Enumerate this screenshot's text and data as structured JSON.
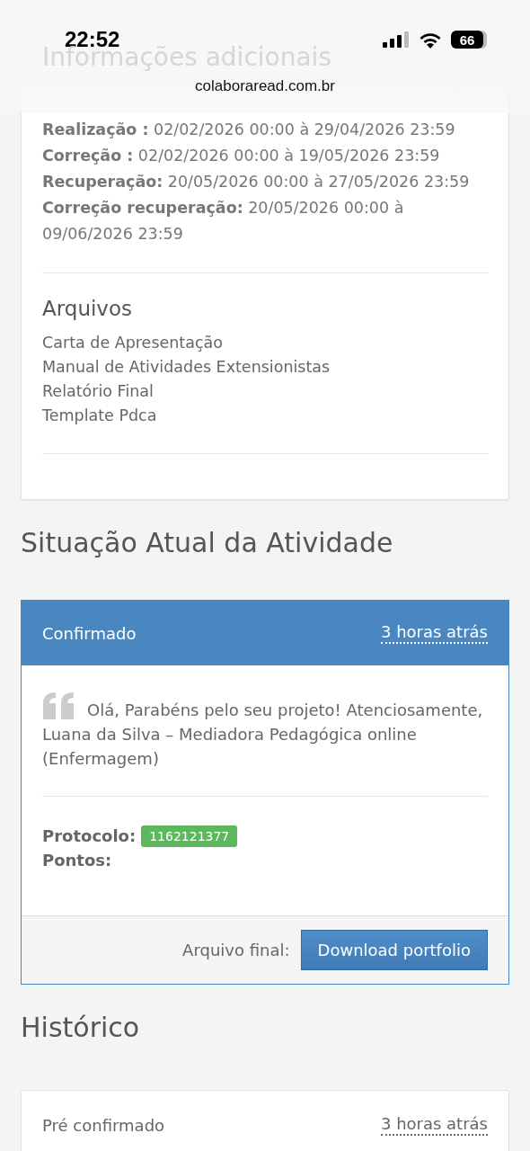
{
  "status_bar": {
    "time": "22:52",
    "battery": "66"
  },
  "address_bar": {
    "url": "colaboraread.com.br"
  },
  "info_card": {
    "title": "Informações adicionais",
    "dates": [
      "**Realização :** 02/02/2026 00:00 à 29/04/2026 23:59",
      "**Correção :** 02/02/2026 00:00 à 19/05/2026 23:59",
      "**Recuperação:** 20/05/2026 00:00 à 27/05/2026 23:59",
      "**Correção recuperação:** 20/05/2026 00:00 à 09/06/2026 23:59"
    ],
    "files_title": "Arquivos",
    "files": [
      "Carta de Apresentação",
      "Manual de Atividades Extensionistas",
      "Relatório Final",
      "Template Pdca"
    ]
  },
  "status_section": {
    "title": "Situação Atual da Atividade",
    "status": "Confirmado",
    "time": "3 horas atrás",
    "comment": "Olá, Parabéns pelo seu projeto! Atenciosamente, Luana da Silva – Mediadora Pedagógica online (Enfermagem)",
    "protocol_label": "Protocolo:",
    "protocol": "1162121377",
    "points_label": "Pontos:",
    "file_label": "Arquivo final:",
    "download_button": "Download portfolio"
  },
  "history": {
    "title": "Histórico",
    "entries": [
      {
        "status": "Pré confirmado",
        "time": "3 horas atrás"
      }
    ]
  }
}
